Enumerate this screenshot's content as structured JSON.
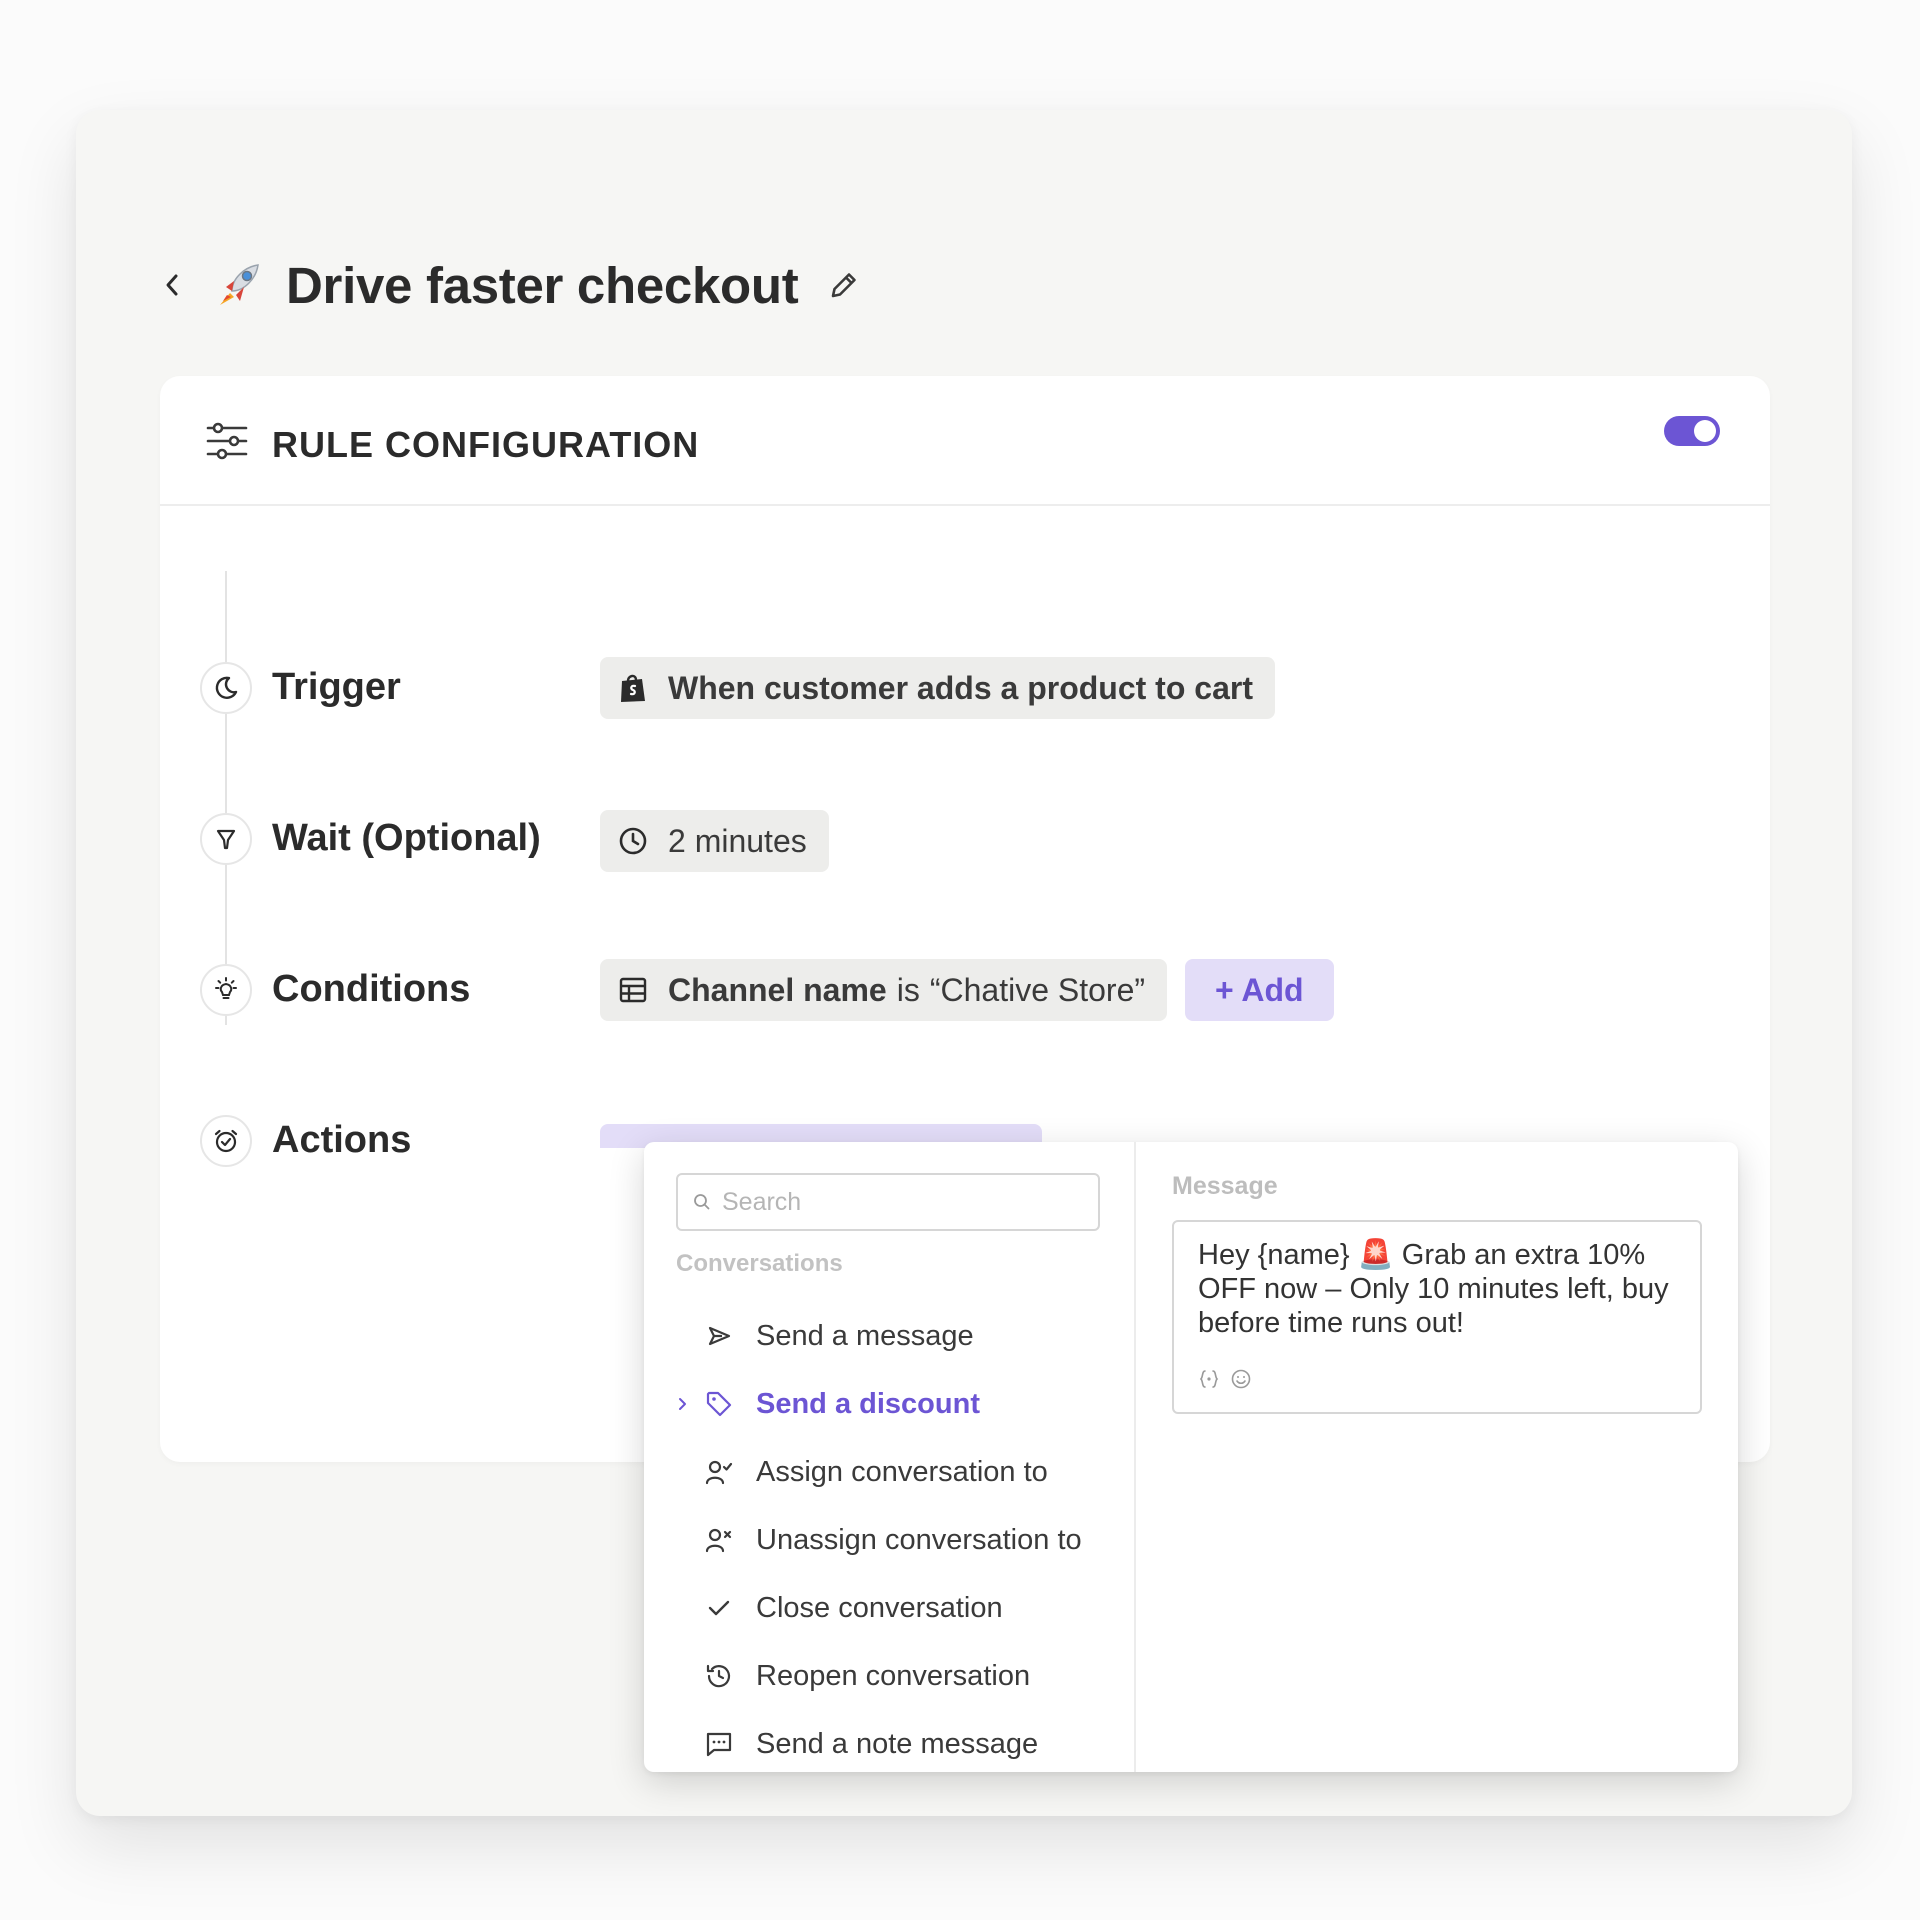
{
  "header": {
    "title": "Drive faster checkout"
  },
  "rule": {
    "section_title": "RULE CONFIGURATION",
    "enabled": true,
    "accent_color": "#6c55d4",
    "steps": {
      "trigger": {
        "label": "Trigger",
        "value": "When customer adds a product to cart",
        "icon": "moon-icon"
      },
      "wait": {
        "label": "Wait (Optional)",
        "value": "2 minutes",
        "icon": "funnel-icon"
      },
      "conditions": {
        "label": "Conditions",
        "field": "Channel name",
        "operator": "is",
        "value": "“Chative Store”",
        "add_label": "+ Add",
        "icon": "lightbulb-icon"
      },
      "actions": {
        "label": "Actions",
        "icon": "alarm-clock-icon"
      }
    }
  },
  "dropdown": {
    "search_placeholder": "Search",
    "section_label": "Conversations",
    "items": [
      {
        "label": "Send a message",
        "icon": "send-icon",
        "active": false
      },
      {
        "label": "Send a discount",
        "icon": "tag-icon",
        "active": true
      },
      {
        "label": "Assign conversation to",
        "icon": "user-check-icon",
        "active": false
      },
      {
        "label": "Unassign conversation to",
        "icon": "user-x-icon",
        "active": false
      },
      {
        "label": "Close conversation",
        "icon": "check-icon",
        "active": false
      },
      {
        "label": "Reopen conversation",
        "icon": "history-icon",
        "active": false
      },
      {
        "label": "Send a note message",
        "icon": "message-square-icon",
        "active": false
      }
    ],
    "message": {
      "label": "Message",
      "text": "Hey {name} 🚨 Grab an extra 10% OFF now – Only 10 minutes left, buy before time runs out!"
    }
  }
}
